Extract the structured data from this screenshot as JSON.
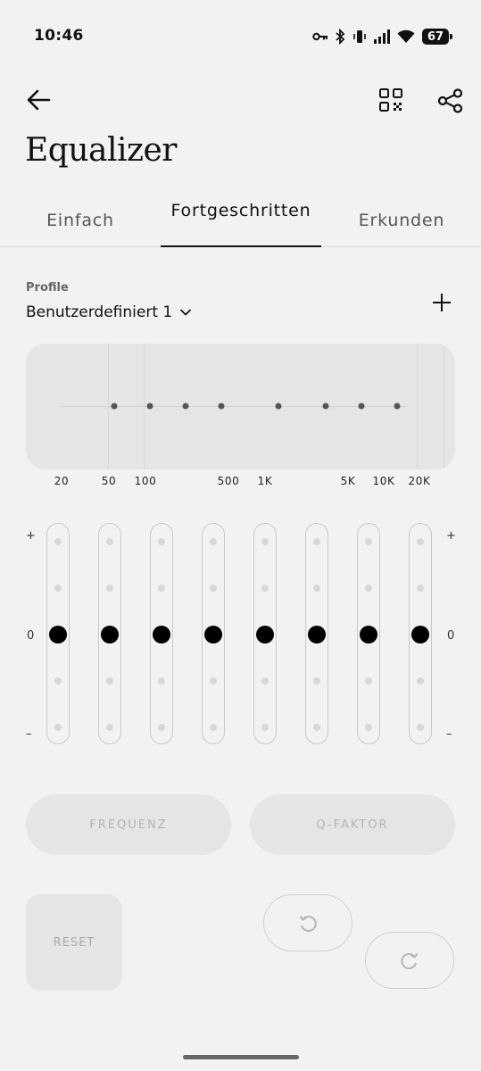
{
  "status": {
    "time": "10:46",
    "battery": "67"
  },
  "header": {
    "title": "Equalizer"
  },
  "tabs": [
    {
      "label": "Einfach",
      "active": false
    },
    {
      "label": "Fortgeschritten",
      "active": true
    },
    {
      "label": "Erkunden",
      "active": false
    }
  ],
  "profile": {
    "label": "Profile",
    "selected": "Benutzerdefiniert 1"
  },
  "graph": {
    "frequency_labels": [
      "20",
      "50",
      "100",
      "500",
      "1K",
      "5K",
      "10K",
      "20K"
    ]
  },
  "sliders": {
    "plus_label": "+",
    "zero_label": "0",
    "minus_label": "–",
    "bands": [
      {
        "gain": 0
      },
      {
        "gain": 0
      },
      {
        "gain": 0
      },
      {
        "gain": 0
      },
      {
        "gain": 0
      },
      {
        "gain": 0
      },
      {
        "gain": 0
      },
      {
        "gain": 0
      }
    ]
  },
  "controls": {
    "frequency": "FREQUENZ",
    "q_factor": "Q-FAKTOR",
    "reset": "RESET"
  },
  "colors": {
    "background": "#f2f2f2",
    "accent": "#000000",
    "disabled_text": "#b3b3b3"
  }
}
